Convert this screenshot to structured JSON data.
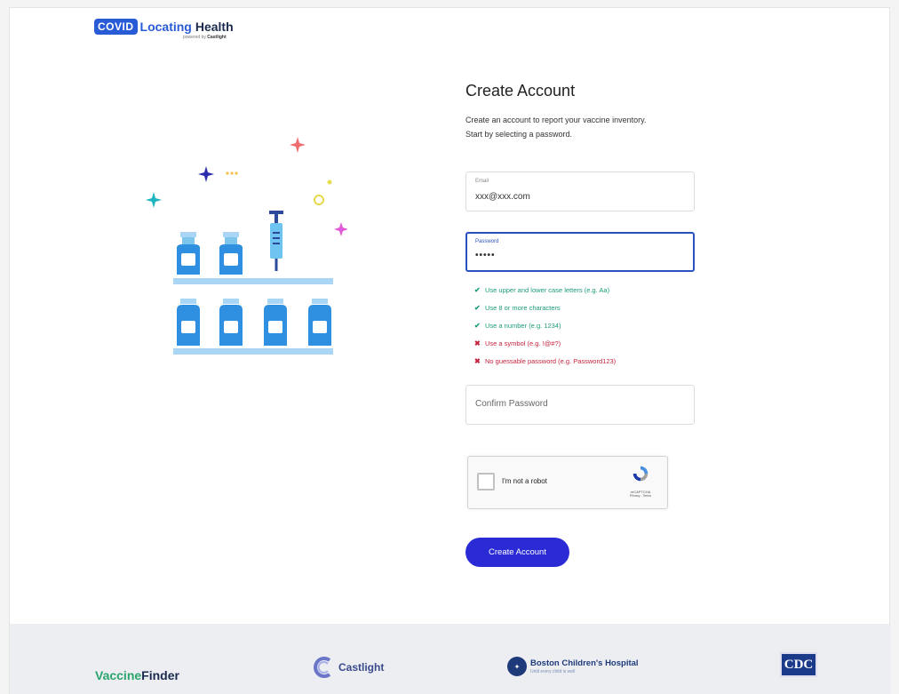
{
  "header": {
    "logo_badge": "COVID",
    "logo_locating": "Locating",
    "logo_health": "Health",
    "logo_powered_prefix": "powered by",
    "logo_powered_brand": "Castlight"
  },
  "form": {
    "title": "Create Account",
    "description_line1": "Create an account to report your vaccine inventory.",
    "description_line2": "Start by selecting a password.",
    "email": {
      "label": "Email",
      "value": "xxx@xxx.com"
    },
    "password": {
      "label": "Password",
      "value": "•••••"
    },
    "password_rules": [
      {
        "text": "Use upper and lower case letters (e.g. Aa)",
        "status": "ok"
      },
      {
        "text": "Use 8 or more characters",
        "status": "ok"
      },
      {
        "text": "Use a number (e.g. 1234)",
        "status": "ok"
      },
      {
        "text": "Use a symbol (e.g. !@#?)",
        "status": "bad"
      },
      {
        "text": "No guessable password (e.g. Password123)",
        "status": "bad"
      }
    ],
    "confirm": {
      "placeholder": "Confirm Password"
    },
    "recaptcha": {
      "label": "I'm not a robot",
      "brand": "reCAPTCHA",
      "links": "Privacy - Terms"
    },
    "submit_label": "Create Account"
  },
  "footer": {
    "vaccinefinder_a": "Vaccine",
    "vaccinefinder_b": "Finder",
    "castlight": "Castlight",
    "bch_name": "Boston Children's Hospital",
    "bch_tagline": "Until every child is well",
    "cdc": "CDC"
  },
  "colors": {
    "accent": "#2b2bd6",
    "ok": "#1a9b7a",
    "bad": "#c4243e"
  }
}
